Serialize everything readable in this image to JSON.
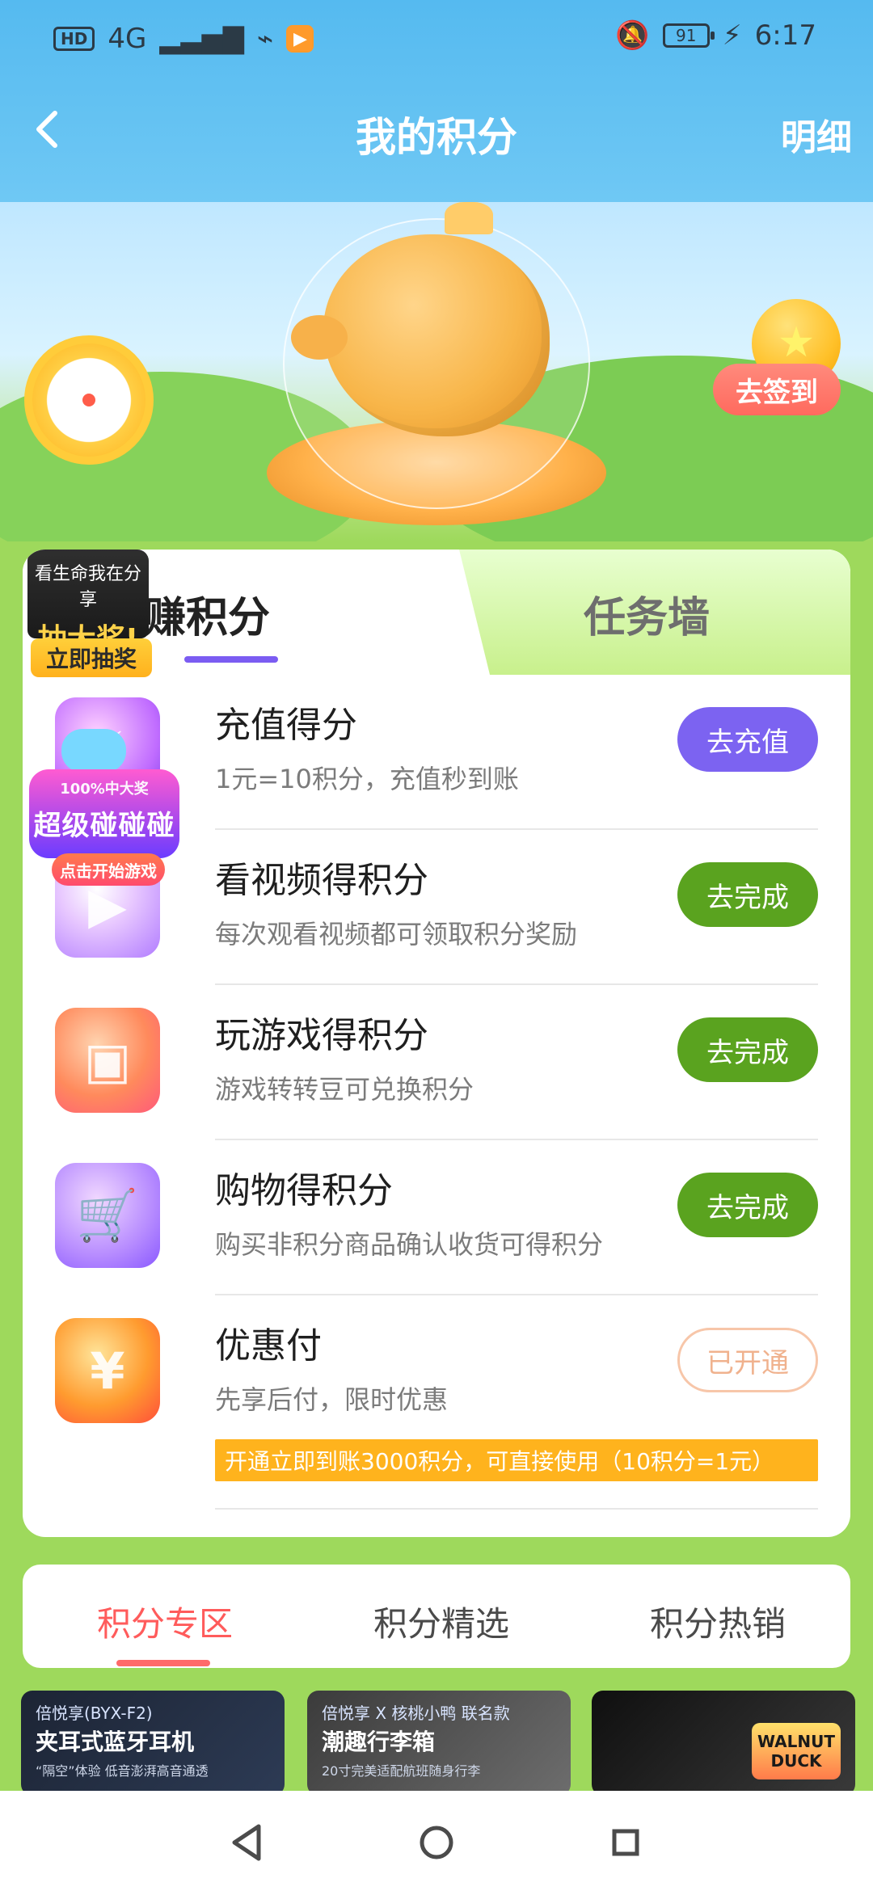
{
  "status": {
    "left": {
      "hd": "HD",
      "network": "4G",
      "wifi_icon": "wifi-icon",
      "app_badge_icon": "play-badge-icon"
    },
    "right": {
      "dnd_icon": "bell-off-icon",
      "battery": "91",
      "charging_icon": "charging-icon",
      "time": "6:17"
    }
  },
  "nav": {
    "title": "我的积分",
    "detail": "明细"
  },
  "banner": {
    "signin": "去签到"
  },
  "earn_card": {
    "tabs": {
      "earn": "赚积分",
      "wall": "任务墙"
    },
    "lottery": {
      "top_small": "看生命我在分享",
      "top_big": "抽大奖!",
      "btn": "立即抽奖"
    },
    "tasks": [
      {
        "title": "充值得分",
        "desc": "1元=10积分，充值秒到账",
        "button": "去充值",
        "icon": "super-collision-icon"
      },
      {
        "title": "看视频得积分",
        "desc": "每次观看视频都可领取积分奖励",
        "button": "去完成",
        "icon": "video-icon"
      },
      {
        "title": "玩游戏得积分",
        "desc": "游戏转转豆可兑换积分",
        "button": "去完成",
        "icon": "tv-icon"
      },
      {
        "title": "购物得积分",
        "desc": "购买非积分商品确认收货可得积分",
        "button": "去完成",
        "icon": "shopping-cart-icon"
      },
      {
        "title": "优惠付",
        "desc": "先享后付，限时优惠",
        "button": "已开通",
        "icon": "coupon-yuan-icon",
        "promo": "开通立即到账3000积分，可直接使用（10积分=1元）"
      }
    ],
    "super_overlay": {
      "small": "100%中大奖",
      "big": "超级碰碰碰",
      "play": "点击开始游戏"
    }
  },
  "zone": {
    "tabs": [
      "积分专区",
      "积分精选",
      "积分热销"
    ]
  },
  "products": [
    {
      "line1": "倍悦享(BYX-F2)",
      "line2": "夹耳式蓝牙耳机",
      "line3": "“隔空”体验 低音澎湃高音通透"
    },
    {
      "line1": "倍悦享 X 核桃小鸭 联名款",
      "line2": "潮趣行李箱",
      "line3": "20寸完美适配航班随身行李"
    },
    {
      "line1": "",
      "line2": "",
      "line3": "",
      "logo": "WALNUT DUCK"
    }
  ]
}
